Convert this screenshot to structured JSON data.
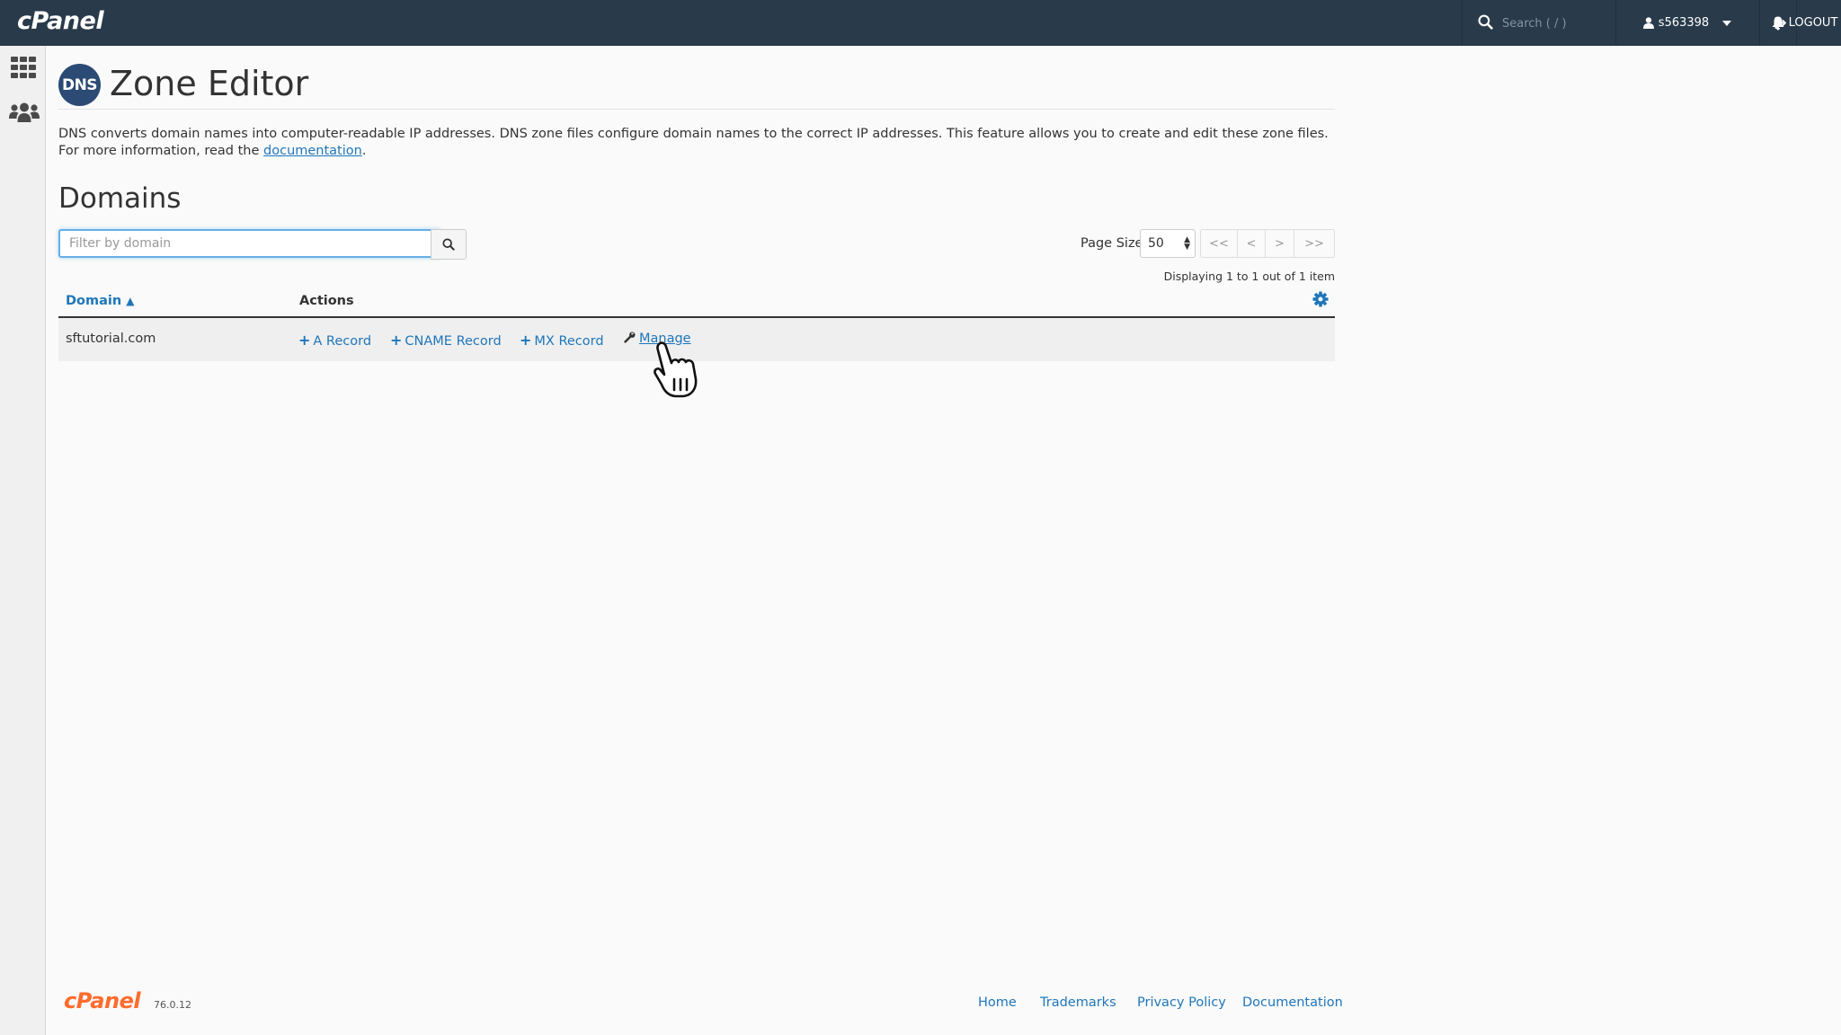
{
  "header": {
    "logo_text": "cPanel",
    "search_placeholder": "Search ( / )",
    "username": "s563398",
    "logout_label": "LOGOUT"
  },
  "sidebar": {
    "items": [
      {
        "icon": "apps-grid-icon"
      },
      {
        "icon": "users-icon"
      }
    ]
  },
  "page": {
    "badge_text": "DNS",
    "title": "Zone Editor",
    "description": "DNS converts domain names into computer-readable IP addresses. DNS zone files configure domain names to the correct IP addresses. This feature allows you to create and edit these zone files. For more information, read the ",
    "doc_link": "documentation",
    "description_end": "."
  },
  "domains": {
    "heading": "Domains",
    "filter_placeholder": "Filter by domain",
    "page_size_label": "Page Size",
    "page_size_value": "50",
    "pager": {
      "first": "<<",
      "prev": "<",
      "next": ">",
      "last": ">>"
    },
    "displaying": "Displaying 1 to 1 out of 1 item",
    "columns": {
      "domain": "Domain",
      "actions": "Actions"
    },
    "sort_indicator": "▲",
    "rows": [
      {
        "domain": "sftutorial.com",
        "actions": {
          "a_record": "A Record",
          "cname_record": "CNAME Record",
          "mx_record": "MX Record",
          "manage": "Manage"
        }
      }
    ]
  },
  "footer": {
    "logo_text": "cPanel",
    "version": "76.0.12",
    "links": {
      "home": "Home",
      "trademarks": "Trademarks",
      "privacy": "Privacy Policy",
      "documentation": "Documentation"
    }
  },
  "colors": {
    "topbar": "#293a4a",
    "link": "#1f76ba",
    "brand_orange": "#ff6c2c"
  }
}
